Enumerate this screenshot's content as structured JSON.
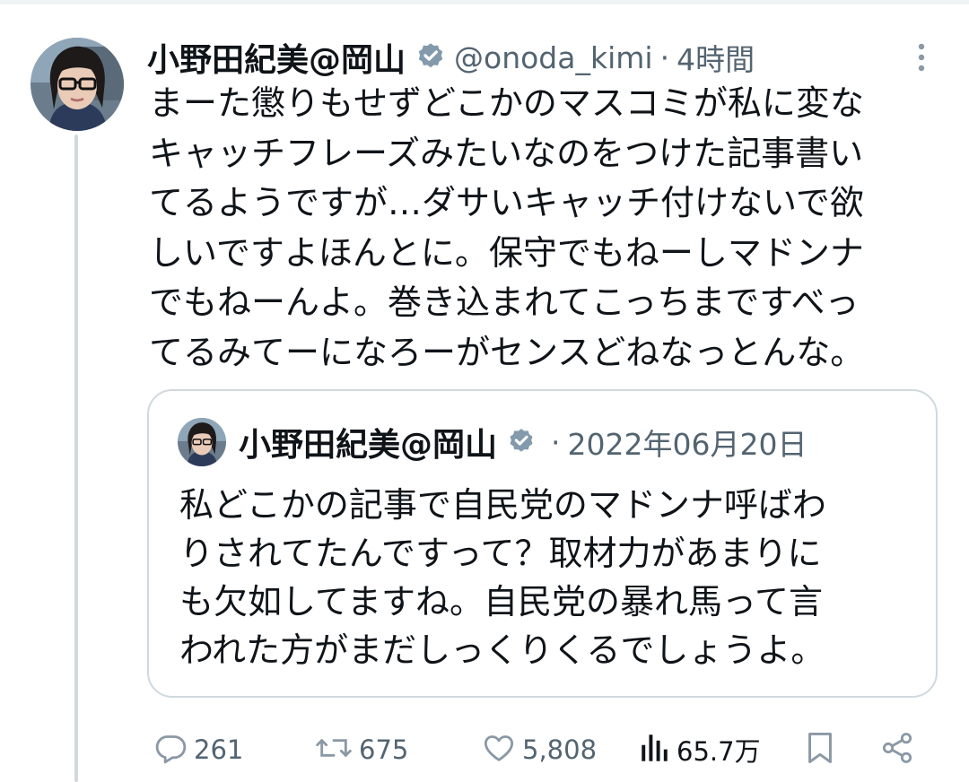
{
  "tweet": {
    "display_name": "小野田紀美@岡山",
    "handle": "@onoda_kimi",
    "separator": "·",
    "time": "4時間",
    "text_lines": [
      "まーた懲りもせずどこかのマスコミが私に変な",
      "キャッチフレーズみたいなのをつけた記事書い",
      "てるようですが…ダサいキャッチ付けないで欲",
      "しいですよほんとに。保守でもねーしマドンナ",
      "でもねーんよ。巻き込まれてこっちまですべっ",
      "てるみてーになろーがセンスどねなっとんな。"
    ]
  },
  "quote": {
    "display_name": "小野田紀美@岡山",
    "separator": "·",
    "date": "2022年06月20日",
    "text_lines": [
      "私どこかの記事で自民党のマドンナ呼ばわ",
      "りされてたんですって？取材力があまりに",
      "も欠如してますね。自民党の暴れ馬って言",
      "われた方がまだしっくりくるでしょうよ。"
    ]
  },
  "actions": {
    "replies": "261",
    "reposts": "675",
    "likes": "5,808",
    "views": "65.7万"
  },
  "colors": {
    "text": "#0f1419",
    "muted": "#536471",
    "border": "#cfd9de",
    "verified": "#829aab"
  }
}
